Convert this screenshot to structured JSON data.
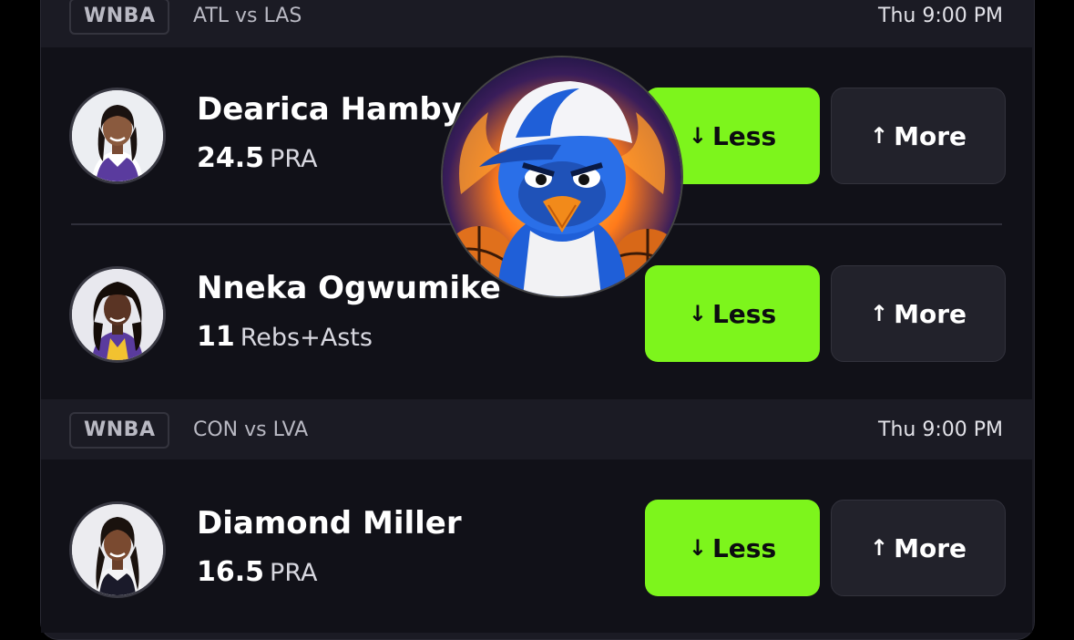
{
  "games": [
    {
      "league": "WNBA",
      "matchup": "ATL vs LAS",
      "time": "Thu 9:00 PM",
      "props": [
        {
          "player": "Dearica Hamby",
          "line": "24.5",
          "stat": "PRA",
          "less_label": "Less",
          "more_label": "More"
        },
        {
          "player": "Nneka Ogwumike",
          "line": "11",
          "stat": "Rebs+Asts",
          "less_label": "Less",
          "more_label": "More"
        }
      ]
    },
    {
      "league": "WNBA",
      "matchup": "CON vs LVA",
      "time": "Thu 9:00 PM",
      "props": [
        {
          "player": "Diamond Miller",
          "line": "16.5",
          "stat": "PRA",
          "less_label": "Less",
          "more_label": "More"
        }
      ]
    }
  ],
  "icons": {
    "less": "arrow-down-icon",
    "more": "arrow-up-icon",
    "mascot": "blue-bird-mascot-logo"
  },
  "colors": {
    "less_button": "#7df51c",
    "more_button": "#22222b",
    "card": "#111118",
    "header": "#1b1b24"
  }
}
